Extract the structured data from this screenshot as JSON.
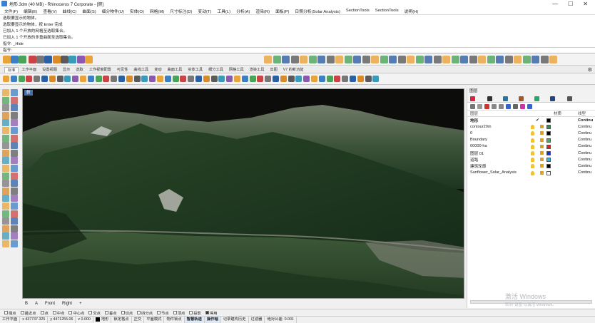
{
  "window": {
    "title": "地形.3dm (40 MB) - Rhinoceros 7 Corporate - [俯]",
    "controls": [
      "—",
      "☐",
      "✕"
    ]
  },
  "menubar": [
    "文件(F)",
    "编辑(E)",
    "查看(V)",
    "曲线(C)",
    "曲面(S)",
    "细分物件(U)",
    "实体(O)",
    "网格(M)",
    "尺寸标注(D)",
    "变动(T)",
    "工具(L)",
    "分析(A)",
    "渲染(R)",
    "面板(P)",
    "日照分析(Solar Analysis)",
    "SectionTools",
    "SectionTools",
    "说明(H)"
  ],
  "command_history": [
    "选取要显示的物体。",
    "选取要显示的物体，按 Enter 完成",
    "已加入 1 个开放的网格至选取集合。",
    "已加入 1 个开放的多重曲面至选取集合。",
    "指令: _Hide"
  ],
  "command_prompt": "指令:",
  "tabs": [
    "标准",
    "工作平面",
    "设置视图",
    "显示",
    "选取",
    "工作视窗配置",
    "可见性",
    "曲线工具",
    "变动",
    "曲面工具",
    "实体工具",
    "细分工具",
    "网格工具",
    "渲染工具",
    "出图",
    "V7 的新功能"
  ],
  "viewport": {
    "label": "俯"
  },
  "viewport_tabs": [
    "B",
    "A",
    "Front",
    "Right",
    "+"
  ],
  "layers_panel": {
    "title": "图层",
    "column_headers": {
      "name": "图层",
      "material": "材质",
      "linetype": "线型"
    },
    "layers": [
      {
        "name": "地形",
        "color": "#000000",
        "linetype": "Continu",
        "current": true
      },
      {
        "name": "contour20m",
        "color": "#3a8a50",
        "linetype": "Continu"
      },
      {
        "name": "0",
        "color": "#000000",
        "linetype": "Continu"
      },
      {
        "name": "Boundary",
        "color": "#44aa66",
        "linetype": "Continu"
      },
      {
        "name": "00000-ha",
        "color": "#dd2222",
        "linetype": "Continu"
      },
      {
        "name": "图层 01",
        "color": "#1a2bd6",
        "linetype": "Continu"
      },
      {
        "name": "道路",
        "color": "#22bbdd",
        "linetype": "Continu"
      },
      {
        "name": "建筑轮廓",
        "color": "#000000",
        "linetype": "Continu"
      },
      {
        "name": "Sunflower_Solar_Analysis",
        "color": "#ffffff",
        "linetype": "Continu"
      }
    ]
  },
  "watermark": {
    "line1": "激活 Windows",
    "line2": "转到\"设置\"以激活 Windows。"
  },
  "osnap": [
    {
      "label": "端点",
      "on": false
    },
    {
      "label": "最近点",
      "on": false
    },
    {
      "label": "点",
      "on": false
    },
    {
      "label": "中点",
      "on": false
    },
    {
      "label": "中心点",
      "on": false
    },
    {
      "label": "交点",
      "on": false
    },
    {
      "label": "垂点",
      "on": false
    },
    {
      "label": "切点",
      "on": false
    },
    {
      "label": "四分点",
      "on": false
    },
    {
      "label": "节点",
      "on": false
    },
    {
      "label": "顶点",
      "on": false
    },
    {
      "label": "投影",
      "on": false
    },
    {
      "label": "停用",
      "on": true
    }
  ],
  "statusbar": {
    "cplane": "工作平面",
    "coords": "x 437737.325",
    "coords_y": "y 4471255.06",
    "coords_z": "z 0.000",
    "layer": "地形",
    "toggles": [
      {
        "label": "锁定格点",
        "hl": false
      },
      {
        "label": "正交",
        "hl": false
      },
      {
        "label": "平面模式",
        "hl": false
      },
      {
        "label": "物件锁点",
        "hl": false
      },
      {
        "label": "智慧轨迹",
        "hl": true
      },
      {
        "label": "操作轴",
        "hl": true
      },
      {
        "label": "记录建构历史",
        "hl": false
      },
      {
        "label": "过滤器",
        "hl": false
      },
      {
        "label": "绝对公差: 0.001",
        "hl": false
      }
    ]
  },
  "colors": {
    "accent": "#4a6fa5",
    "terrain_dark": "#1e3a22",
    "terrain_light": "#6b7a5e",
    "sky": "#0b0c0a"
  }
}
